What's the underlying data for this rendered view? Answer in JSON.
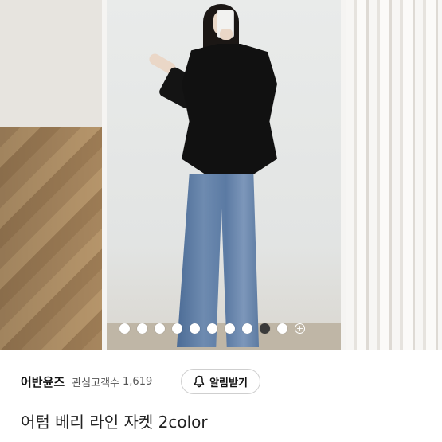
{
  "carousel": {
    "total_dots": 10,
    "active_index": 8,
    "more_icon": "plus-icon"
  },
  "shop": {
    "name": "어반윤즈",
    "follower_label": "관심고객수",
    "follower_count": "1,619",
    "alarm_button_label": "알림받기",
    "alarm_icon": "bell-icon"
  },
  "product": {
    "title": "어텀 베리 라인 자켓 2color"
  }
}
